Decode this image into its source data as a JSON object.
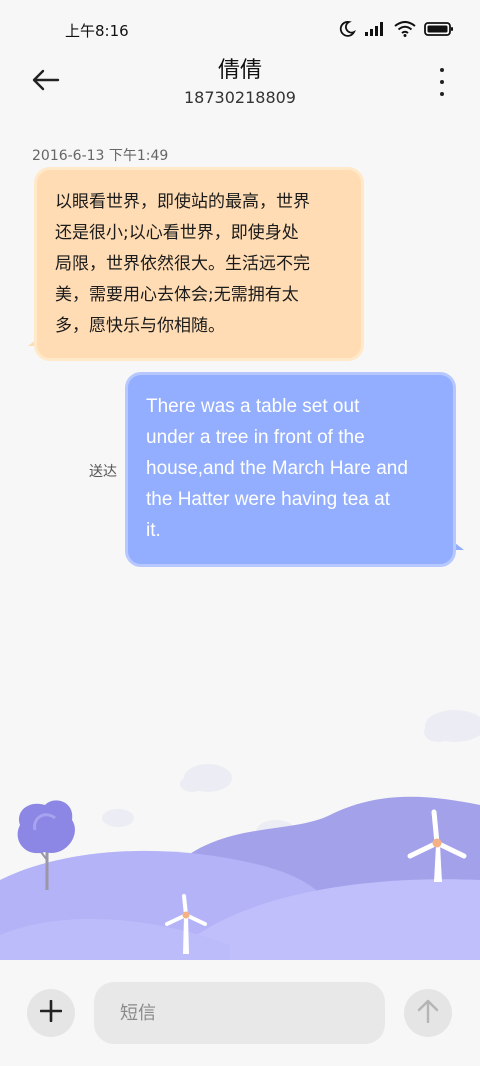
{
  "status_bar": {
    "time": "上午8:16",
    "icons": [
      "moon-icon",
      "signal-icon",
      "wifi-icon",
      "battery-icon"
    ]
  },
  "header": {
    "contact_name": "倩倩",
    "contact_number": "18730218809",
    "back_icon": "arrow-left-icon",
    "more_icon": "more-vertical-icon"
  },
  "conversation": {
    "timestamp": "2016-6-13 下午1:49",
    "messages": [
      {
        "direction": "incoming",
        "lines": [
          "以眼看世界，即使站的最高，世界",
          "还是很小;以心看世界，即使身处",
          "局限，世界依然很大。生活远不完",
          "美，需要用心去体会;无需拥有太",
          "多，愿快乐与你相随。"
        ]
      },
      {
        "direction": "outgoing",
        "lines": [
          "There was a table set out",
          "under a tree in front of the",
          "house,and the March Hare and",
          "the Hatter were having tea at",
          "it."
        ],
        "status": "送达"
      }
    ]
  },
  "input_bar": {
    "placeholder": "短信",
    "value": "",
    "add_icon": "plus-icon",
    "send_icon": "arrow-up-icon"
  },
  "colors": {
    "incoming_bubble": "#ffdcb4",
    "outgoing_bubble": "#93aefe",
    "hills_light": "#b7b6fa",
    "hills_dark": "#9b98e8"
  }
}
